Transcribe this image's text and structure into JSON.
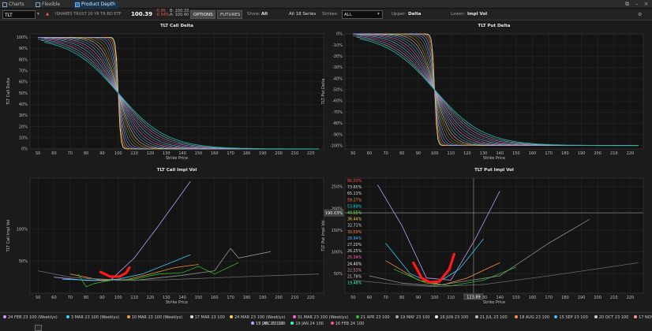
{
  "tabs": [
    {
      "label": "Charts",
      "active": false
    },
    {
      "label": "Flexible Grid",
      "active": false
    },
    {
      "label": "Product Depth",
      "active": true
    }
  ],
  "toolbar": {
    "symbol": "TLT",
    "description": "ISHARES TRUST 20 YR TR BD ETF",
    "last": "100.39",
    "change": "-0.95",
    "change_pct": "-0.94%",
    "bid": "B: 100.33",
    "ask": "A: 100.40",
    "options_label": "OPTIONS",
    "futures_label": "FUTURES",
    "show_label": "Show:",
    "show_value": "All",
    "series_value": "All 18 Series",
    "strikes_label": "Strikes:",
    "strikes_value": "ALL",
    "upper_label": "Upper:",
    "upper_value": "Delta",
    "lower_label": "Lower:",
    "lower_value": "Impl Vol"
  },
  "crosshair": {
    "price_label": "190.03%",
    "strike_label": "123.89"
  },
  "vol_readout": [
    "86.03%",
    "73.65%",
    "65.13%",
    "59.37%",
    "53.69%",
    "40.55%",
    "36.44%",
    "32.71%",
    "30.59%",
    "28.94%",
    "27.20%",
    "26.25%",
    "25.34%",
    "24.40%",
    "22.53%",
    "21.78%",
    "19.48%"
  ],
  "vol_readout_colors": [
    "#ff4d4d",
    "#dddddd",
    "#dddddd",
    "#ff8a4d",
    "#00e5ff",
    "#7cff4d",
    "#ffd24d",
    "#dddddd",
    "#ff8a4d",
    "#4db8ff",
    "#dddddd",
    "#dddddd",
    "#ff66cc",
    "#ffffff",
    "#ff9999",
    "#dddddd",
    "#33ffcc"
  ],
  "chart_data": [
    {
      "type": "line",
      "title": "TLT Call Delta",
      "xlabel": "Strike Price",
      "ylabel": "TLT Call Delta",
      "xlim": [
        45,
        228
      ],
      "ylim": [
        0,
        1.03
      ],
      "grid": true,
      "xticks": [
        "50",
        "60",
        "70",
        "80",
        "90",
        "100",
        "110",
        "120",
        "130",
        "140",
        "150",
        "160",
        "170",
        "180",
        "190",
        "200",
        "210",
        "220"
      ],
      "yticks": [
        "0%",
        "10%",
        "20%",
        "30%",
        "40%",
        "50%",
        "60%",
        "70%",
        "80%",
        "90%",
        "100%"
      ],
      "curve_kind": "call",
      "center": 100,
      "wmin": 0.7,
      "wmax": 15,
      "series_count": 18,
      "x_range": [
        50,
        225
      ]
    },
    {
      "type": "line",
      "title": "TLT Put Delta",
      "xlabel": "Strike Price",
      "ylabel": "TLT Put Delta",
      "xlim": [
        45,
        228
      ],
      "ylim": [
        -1.03,
        0
      ],
      "grid": true,
      "xticks": [
        "50",
        "60",
        "70",
        "80",
        "90",
        "100",
        "110",
        "120",
        "130",
        "140",
        "150",
        "160",
        "170",
        "180",
        "190",
        "200",
        "210",
        "220"
      ],
      "yticks": [
        "0%",
        "-10%",
        "-20%",
        "-30%",
        "-40%",
        "-50%",
        "-60%",
        "-70%",
        "-80%",
        "-90%",
        "-100%"
      ],
      "curve_kind": "put",
      "center": 100,
      "wmin": 0.7,
      "wmax": 15,
      "series_count": 18,
      "x_range": [
        50,
        225
      ]
    },
    {
      "type": "line",
      "title": "TLT Call Impl Vol",
      "xlabel": "Strike Price",
      "ylabel": "TLT Call Impl Vol",
      "xlim": [
        45,
        228
      ],
      "ylim": [
        0,
        1.8
      ],
      "grid": true,
      "xticks": [
        "50",
        "60",
        "70",
        "80",
        "90",
        "100",
        "110",
        "120",
        "130",
        "140",
        "150",
        "160",
        "170",
        "180",
        "190",
        "200",
        "210",
        "220"
      ],
      "yticks": [
        "50%",
        "100%"
      ],
      "ytick_values": [
        0.5,
        1.0
      ],
      "series": [
        {
          "name": "24 FEB 23 100 (Weeklys)",
          "color": "#c7a0ff",
          "x": [
            60,
            80,
            95,
            110,
            125,
            145
          ],
          "y": [
            0.25,
            0.2,
            0.2,
            0.55,
            1.05,
            1.75
          ]
        },
        {
          "name": "3 MAR 23 100 (Weeklys)",
          "color": "#33d6ff",
          "x": [
            65,
            85,
            100,
            115,
            130,
            145
          ],
          "y": [
            0.22,
            0.2,
            0.22,
            0.3,
            0.45,
            0.6
          ]
        },
        {
          "name": "10 MAR 23 100 (Weeklys)",
          "color": "#ff9933",
          "x": [
            70,
            90,
            105,
            120,
            135,
            150
          ],
          "y": [
            0.3,
            0.2,
            0.21,
            0.3,
            0.4,
            0.45
          ]
        },
        {
          "name": "24 MAR 23 100",
          "color": "#2fbf2f",
          "x": [
            75,
            80,
            85,
            95,
            110,
            125,
            140,
            150,
            160,
            175
          ],
          "y": [
            0.3,
            0.1,
            0.15,
            0.2,
            0.22,
            0.3,
            0.32,
            0.42,
            0.3,
            0.48
          ]
        },
        {
          "name": "19 JAN 24 100",
          "color": "#999999",
          "x": [
            80,
            110,
            140,
            160,
            170,
            175,
            185,
            195
          ],
          "y": [
            0.23,
            0.2,
            0.28,
            0.35,
            0.7,
            0.55,
            0.6,
            0.65
          ]
        },
        {
          "name": "17 JAN 25 100",
          "color": "#6f6f6f",
          "x": [
            50,
            70,
            100,
            130,
            160,
            190,
            225
          ],
          "y": [
            0.35,
            0.25,
            0.2,
            0.21,
            0.24,
            0.27,
            0.3
          ]
        }
      ],
      "annotation": {
        "kind": "drawn-marker",
        "color": "#ff1a1a",
        "x": [
          89,
          95,
          101,
          105,
          107
        ],
        "y": [
          0.33,
          0.26,
          0.26,
          0.32,
          0.4
        ]
      }
    },
    {
      "type": "line",
      "title": "TLT Put Impl Vol",
      "xlabel": "Strike Price",
      "ylabel": "TLT Put Impl Vol",
      "xlim": [
        45,
        228
      ],
      "ylim": [
        0.05,
        2.7
      ],
      "grid": true,
      "xticks": [
        "50",
        "60",
        "70",
        "80",
        "90",
        "100",
        "110",
        "120",
        "130",
        "140",
        "150",
        "160",
        "170",
        "180",
        "190",
        "200",
        "210",
        "220"
      ],
      "yticks": [
        "50%",
        "100%",
        "150%",
        "200%",
        "250%"
      ],
      "ytick_values": [
        0.5,
        1.0,
        1.5,
        2.0,
        2.5
      ],
      "series": [
        {
          "name": "24 FEB 23 100 (Weeklys)",
          "color": "#c7a0ff",
          "x": [
            65,
            80,
            95,
            110,
            125,
            140
          ],
          "y": [
            2.55,
            1.6,
            0.4,
            0.35,
            1.3,
            2.4
          ]
        },
        {
          "name": "3 MAR 23 100 (Weeklys)",
          "color": "#33d6ff",
          "x": [
            70,
            85,
            100,
            115,
            130
          ],
          "y": [
            1.2,
            0.5,
            0.25,
            0.6,
            1.3
          ]
        },
        {
          "name": "10 MAR 23 100 (Weeklys)",
          "color": "#ff9933",
          "x": [
            70,
            90,
            105,
            120,
            140
          ],
          "y": [
            0.8,
            0.35,
            0.24,
            0.4,
            0.75
          ]
        },
        {
          "name": "24 MAR 23 100",
          "color": "#2fbf2f",
          "x": [
            75,
            95,
            110,
            130,
            150
          ],
          "y": [
            0.6,
            0.28,
            0.22,
            0.35,
            0.65
          ]
        },
        {
          "name": "19 JAN 24 100",
          "color": "#999999",
          "x": [
            60,
            80,
            100,
            140,
            170,
            195
          ],
          "y": [
            0.45,
            0.28,
            0.22,
            0.45,
            1.2,
            1.75
          ]
        },
        {
          "name": "17 JAN 25 100",
          "color": "#6f6f6f",
          "x": [
            50,
            80,
            100,
            130,
            170,
            225
          ],
          "y": [
            0.35,
            0.24,
            0.2,
            0.25,
            0.45,
            0.75
          ]
        }
      ],
      "annotation": {
        "kind": "drawn-marker",
        "color": "#ff1a1a",
        "x": [
          87,
          92,
          97,
          103,
          109,
          112
        ],
        "y": [
          0.75,
          0.4,
          0.3,
          0.32,
          0.6,
          0.95
        ]
      }
    }
  ],
  "legend": [
    {
      "label": "24 FEB 23 100 (Weeklys)",
      "color": "#c7a0ff"
    },
    {
      "label": "3 MAR 23 100 (Weeklys)",
      "color": "#33d6ff"
    },
    {
      "label": "10 MAR 23 100 (Weeklys)",
      "color": "#ff9933"
    },
    {
      "label": "17 MAR 23 100",
      "color": "#dddddd"
    },
    {
      "label": "24 MAR 23 100 (Weeklys)",
      "color": "#ffd24d"
    },
    {
      "label": "31 MAR 23 100 (Weeklys)",
      "color": "#ff66cc"
    },
    {
      "label": "21 APR 23 100",
      "color": "#2fbf2f"
    },
    {
      "label": "19 MAY 23 100",
      "color": "#aaaaaa"
    },
    {
      "label": "16 JUN 23 100",
      "color": "#eeeeee"
    },
    {
      "label": "21 JUL 23 100",
      "color": "#bbbbbb"
    },
    {
      "label": "18 AUG 23 100",
      "color": "#ff8a4d"
    },
    {
      "label": "15 SEP 23 100",
      "color": "#4db8ff"
    },
    {
      "label": "20 OCT 23 100",
      "color": "#cccccc"
    },
    {
      "label": "17 NOV 23 100",
      "color": "#ff9999"
    },
    {
      "label": "15 DEC 23 100",
      "color": "#cc66ff"
    },
    {
      "label": "19 JAN 24 100",
      "color": "#33ffcc"
    },
    {
      "label": "16 FEB 24 100",
      "color": "#ff4d9a"
    },
    {
      "label": "17 JAN 25 100",
      "color": "#8fb3ff"
    }
  ],
  "delta_palette": [
    "#ffffff",
    "#ffd24d",
    "#ff9933",
    "#c7a0ff",
    "#33d6ff",
    "#ff66cc",
    "#2fbf2f",
    "#ff8a4d",
    "#dddddd",
    "#aaaaaa",
    "#4db8ff",
    "#ff9999",
    "#cc66ff",
    "#33ffcc",
    "#ff4d9a",
    "#8fb3ff",
    "#bbbbbb",
    "#14b8a6"
  ]
}
